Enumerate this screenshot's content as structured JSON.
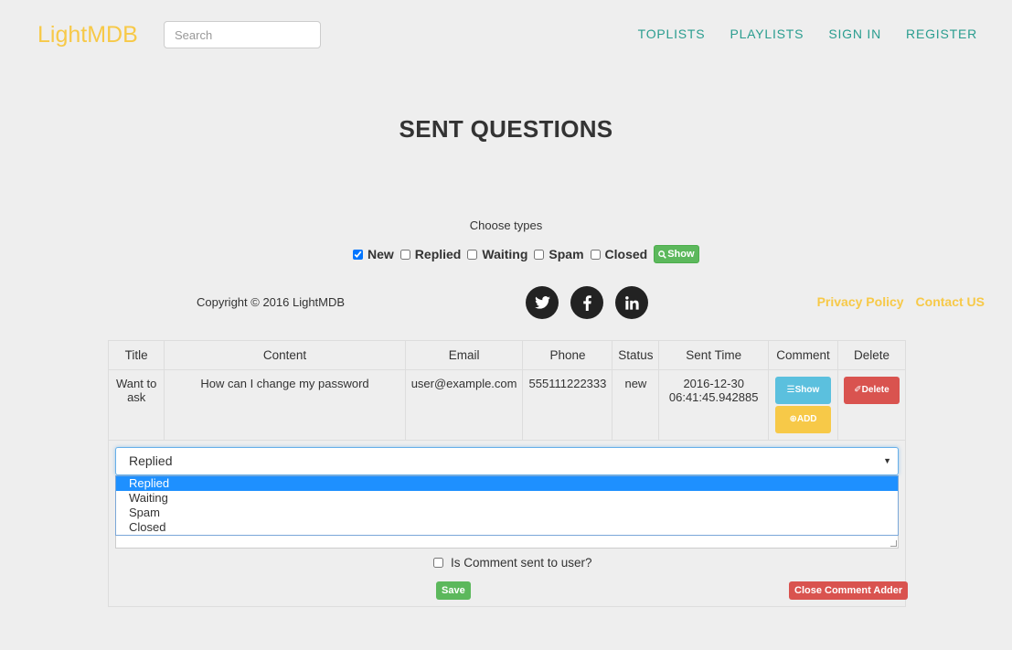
{
  "brand": "LightMDB",
  "search": {
    "placeholder": "Search"
  },
  "nav": [
    "TOPLISTS",
    "PLAYLISTS",
    "SIGN IN",
    "REGISTER"
  ],
  "page_title": "SENT QUESTIONS",
  "choose_types": "Choose types",
  "types": [
    {
      "label": "New",
      "checked": true
    },
    {
      "label": "Replied",
      "checked": false
    },
    {
      "label": "Waiting",
      "checked": false
    },
    {
      "label": "Spam",
      "checked": false
    },
    {
      "label": "Closed",
      "checked": false
    }
  ],
  "show_button": "Show",
  "footer": {
    "copyright": "Copyright © 2016 LightMDB",
    "social": [
      "twitter-icon",
      "facebook-icon",
      "linkedin-icon"
    ],
    "links": [
      "Privacy Policy",
      "Contact US"
    ]
  },
  "table": {
    "headers": [
      "Title",
      "Content",
      "Email",
      "Phone",
      "Status",
      "Sent Time",
      "Comment",
      "Delete"
    ],
    "row": {
      "title": "Want to ask",
      "content": "How can I change my password",
      "email": "user@example.com",
      "phone": "555111222333",
      "status": "new",
      "sent_time": "2016-12-30 06:41:45.942885",
      "comment_show": "Show",
      "comment_add": "ADD",
      "delete": "Delete"
    }
  },
  "comment_adder": {
    "selected": "Replied",
    "options": [
      "Replied",
      "Waiting",
      "Spam",
      "Closed"
    ],
    "sent_label": "Is Comment sent to user?",
    "save": "Save",
    "close": "Close Comment Adder"
  },
  "colors": {
    "brand": "#f7c948",
    "nav": "#2a9d8f",
    "success": "#5cb85c",
    "danger": "#d9534f",
    "info": "#5bc0de"
  }
}
